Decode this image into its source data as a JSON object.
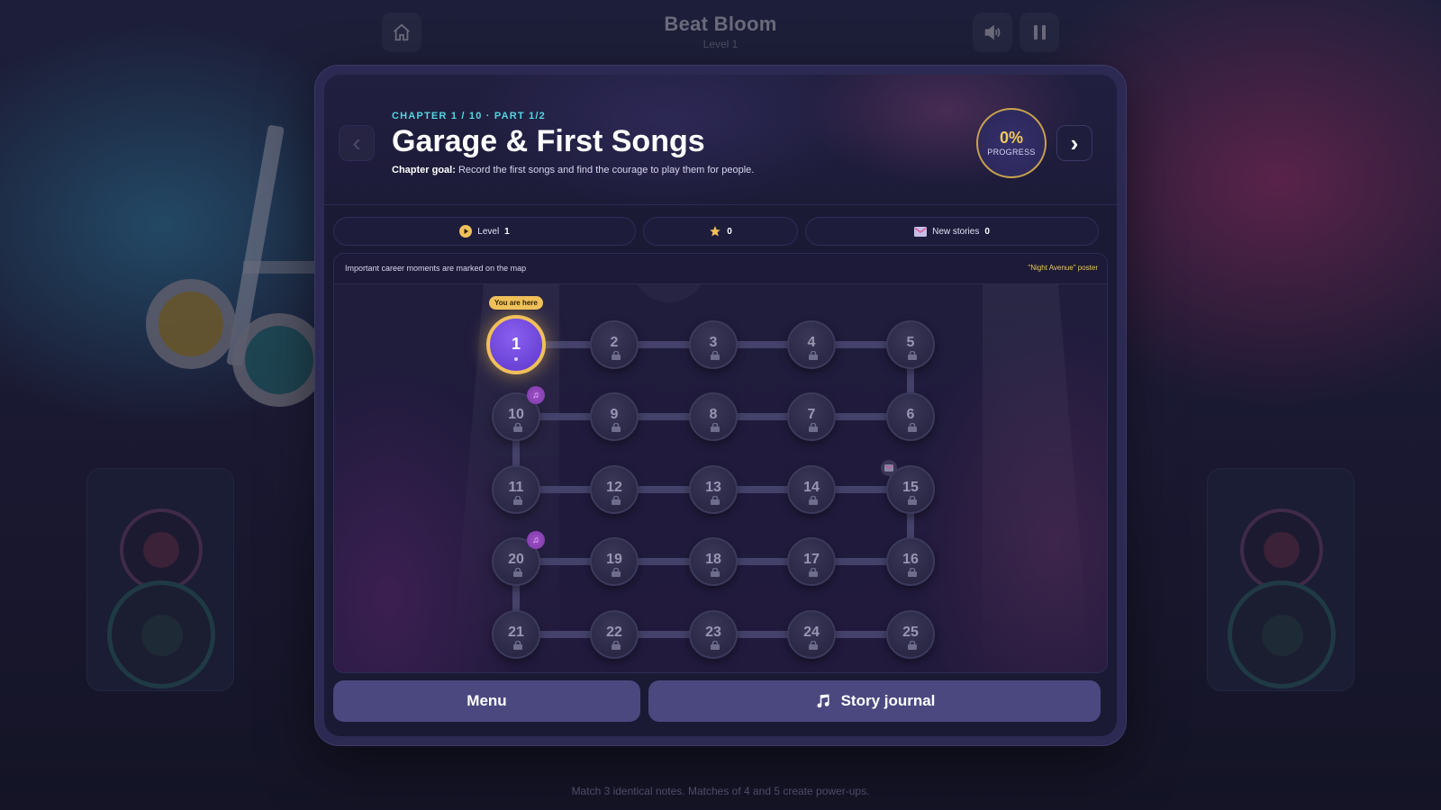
{
  "game": {
    "title": "Beat Bloom",
    "level_label": "Level 1"
  },
  "chapter": {
    "label": "CHAPTER 1 / 10 · PART 1/2",
    "title": "Garage & First Songs",
    "goal_prefix": "Chapter goal:",
    "goal_text": "Record the first songs and find the courage to play them for people.",
    "progress_value": "0%",
    "progress_label": "PROGRESS"
  },
  "stats": {
    "level_label": "Level",
    "level_value": "1",
    "stars_value": "0",
    "stories_label": "New stories",
    "stories_value": "0"
  },
  "map": {
    "info": "Important career moments are marked on the map",
    "poster": "\"Night Avenue\" poster",
    "here_label": "You are here",
    "current_level": 1,
    "nodes": [
      "1",
      "2",
      "3",
      "4",
      "5",
      "6",
      "7",
      "8",
      "9",
      "10",
      "11",
      "12",
      "13",
      "14",
      "15",
      "16",
      "17",
      "18",
      "19",
      "20",
      "21",
      "22",
      "23",
      "24",
      "25"
    ]
  },
  "buttons": {
    "menu": "Menu",
    "journal": "Story journal"
  },
  "hint": "Match 3 identical notes. Matches of 4 and 5 create power-ups.",
  "colors": {
    "accent": "#f0c05a",
    "current_node": "#6a43d6",
    "chapter_label": "#54d6df",
    "button": "#4b4880"
  },
  "icons": {
    "home": "home-icon",
    "volume": "volume-icon",
    "pause": "pause-icon",
    "lock": "lock-icon",
    "star": "star-icon",
    "mail": "mail-icon",
    "music": "music-note-icon",
    "play": "play-icon"
  }
}
